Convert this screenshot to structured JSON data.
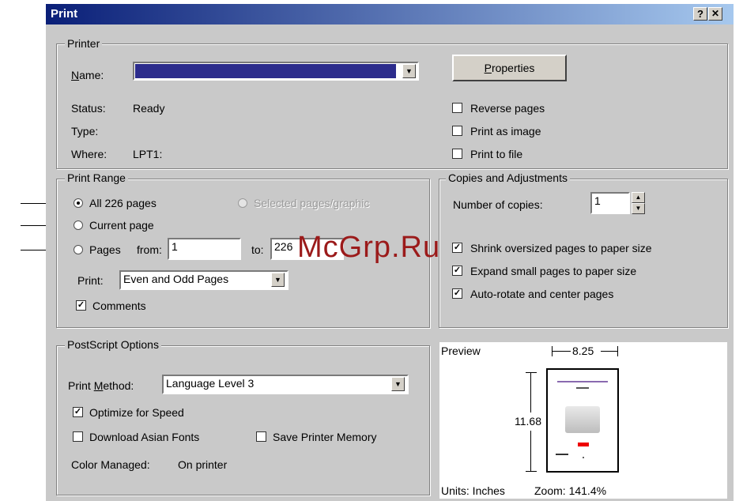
{
  "window": {
    "title": "Print",
    "help_label": "?",
    "close_label": "✕"
  },
  "printer": {
    "group_label": "Printer",
    "name_label": "Name:",
    "name_value": "",
    "properties_label": "Properties",
    "status_label": "Status:",
    "status_value": "Ready",
    "type_label": "Type:",
    "type_value": "",
    "where_label": "Where:",
    "where_value": "LPT1:",
    "reverse_pages": "Reverse pages",
    "print_as_image": "Print as image",
    "print_to_file": "Print to file"
  },
  "range": {
    "group_label": "Print Range",
    "all_pages": "All 226 pages",
    "selected": "Selected pages/graphic",
    "current_page": "Current page",
    "pages": "Pages",
    "from_label": "from:",
    "from_value": "1",
    "to_label": "to:",
    "to_value": "226",
    "print_label": "Print:",
    "print_value": "Even and Odd Pages",
    "comments": "Comments"
  },
  "copies": {
    "group_label": "Copies and Adjustments",
    "number_label": "Number of copies:",
    "number_value": "1",
    "shrink": "Shrink oversized pages to paper size",
    "expand": "Expand small pages to paper size",
    "autorotate": "Auto-rotate and center pages"
  },
  "postscript": {
    "group_label": "PostScript Options",
    "method_label": "Print Method:",
    "method_value": "Language Level 3",
    "optimize": "Optimize for Speed",
    "download_fonts": "Download Asian Fonts",
    "save_memory": "Save Printer Memory",
    "color_label": "Color Managed:",
    "color_value": "On printer"
  },
  "preview": {
    "label": "Preview",
    "width": "8.25",
    "height": "11.68",
    "units": "Units: Inches",
    "zoom": "Zoom: 141.4%"
  },
  "watermark": "McGrp.Ru"
}
